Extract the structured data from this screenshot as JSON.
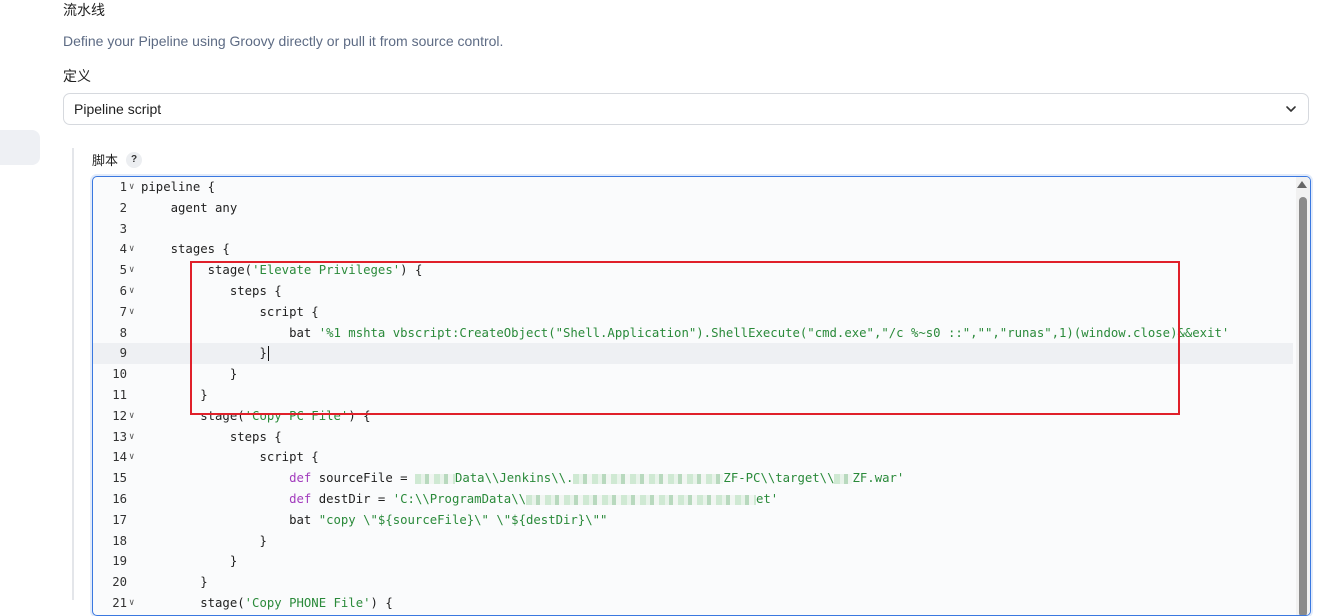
{
  "section": {
    "title": "流水线",
    "description": "Define your Pipeline using Groovy directly or pull it from source control."
  },
  "definition": {
    "label": "定义",
    "selected": "Pipeline script"
  },
  "script": {
    "label": "脚本",
    "help": "?"
  },
  "editor": {
    "lines": [
      {
        "n": "1",
        "fold": true,
        "parts": [
          {
            "t": "pipeline {"
          }
        ]
      },
      {
        "n": "2",
        "fold": false,
        "parts": [
          {
            "t": "    agent any"
          }
        ]
      },
      {
        "n": "3",
        "fold": false,
        "parts": [
          {
            "t": ""
          }
        ]
      },
      {
        "n": "4",
        "fold": true,
        "parts": [
          {
            "t": "    stages {"
          }
        ]
      },
      {
        "n": "5",
        "fold": true,
        "parts": [
          {
            "t": "         stage("
          },
          {
            "t": "'Elevate Privileges'",
            "c": "str"
          },
          {
            "t": ") {"
          }
        ]
      },
      {
        "n": "6",
        "fold": true,
        "parts": [
          {
            "t": "            steps {"
          }
        ]
      },
      {
        "n": "7",
        "fold": true,
        "parts": [
          {
            "t": "                script {"
          }
        ]
      },
      {
        "n": "8",
        "fold": false,
        "parts": [
          {
            "t": "                    bat "
          },
          {
            "t": "'%1 mshta vbscript:CreateObject(\"Shell.Application\").ShellExecute(\"cmd.exe\",\"/c %~s0 ::\",\"\",\"runas\",1)(window.close)&&exit'",
            "c": "str"
          }
        ]
      },
      {
        "n": "9",
        "fold": false,
        "active": true,
        "cursor": true,
        "parts": [
          {
            "t": "                }"
          }
        ]
      },
      {
        "n": "10",
        "fold": false,
        "parts": [
          {
            "t": "            }"
          }
        ]
      },
      {
        "n": "11",
        "fold": false,
        "parts": [
          {
            "t": "        }"
          }
        ]
      },
      {
        "n": "12",
        "fold": true,
        "parts": [
          {
            "t": "        stage("
          },
          {
            "t": "'Copy PC File'",
            "c": "str"
          },
          {
            "t": ") {"
          }
        ]
      },
      {
        "n": "13",
        "fold": true,
        "parts": [
          {
            "t": "            steps {"
          }
        ]
      },
      {
        "n": "14",
        "fold": true,
        "parts": [
          {
            "t": "                script {"
          }
        ]
      },
      {
        "n": "15",
        "fold": false,
        "parts": [
          {
            "t": "                    "
          },
          {
            "t": "def",
            "c": "kw"
          },
          {
            "t": " sourceFile = "
          },
          {
            "blur": 40
          },
          {
            "t": "Data\\\\Jenkins\\\\.",
            "c": "str"
          },
          {
            "blur": 150
          },
          {
            "t": "ZF-PC\\\\target\\\\",
            "c": "str"
          },
          {
            "blur": 18
          },
          {
            "t": "ZF.war'",
            "c": "str"
          }
        ]
      },
      {
        "n": "16",
        "fold": false,
        "parts": [
          {
            "t": "                    "
          },
          {
            "t": "def",
            "c": "kw"
          },
          {
            "t": " destDir = "
          },
          {
            "t": "'C:\\\\ProgramData\\\\",
            "c": "str"
          },
          {
            "blur": 230
          },
          {
            "t": "et'",
            "c": "str"
          }
        ]
      },
      {
        "n": "17",
        "fold": false,
        "parts": [
          {
            "t": "                    bat "
          },
          {
            "t": "\"copy \\\"${sourceFile}\\\" \\\"${destDir}\\\"\"",
            "c": "str"
          }
        ]
      },
      {
        "n": "18",
        "fold": false,
        "parts": [
          {
            "t": "                }"
          }
        ]
      },
      {
        "n": "19",
        "fold": false,
        "parts": [
          {
            "t": "            }"
          }
        ]
      },
      {
        "n": "20",
        "fold": false,
        "parts": [
          {
            "t": "        }"
          }
        ]
      },
      {
        "n": "21",
        "fold": true,
        "parts": [
          {
            "t": "        stage("
          },
          {
            "t": "'Copy PHONE File'",
            "c": "str"
          },
          {
            "t": ") {"
          }
        ]
      }
    ]
  }
}
